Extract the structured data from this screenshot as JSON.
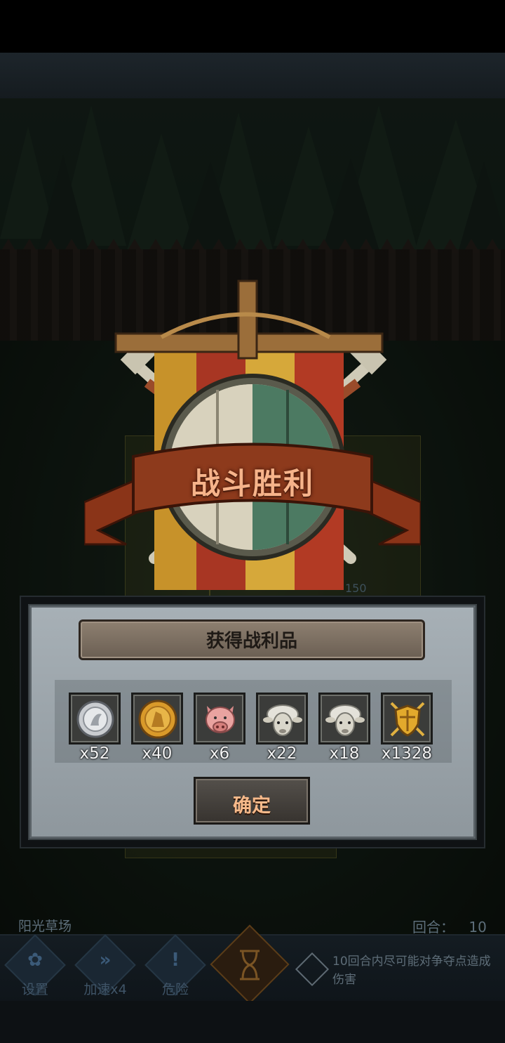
{
  "victory": {
    "title": "战斗胜利"
  },
  "loot_panel": {
    "title": "获得战利品",
    "items": [
      {
        "icon": "silver-coin-icon",
        "qty": "x52"
      },
      {
        "icon": "gold-coin-icon",
        "qty": "x40"
      },
      {
        "icon": "pig-icon",
        "qty": "x6"
      },
      {
        "icon": "sheep-icon",
        "qty": "x22"
      },
      {
        "icon": "sheep-icon",
        "qty": "x18"
      },
      {
        "icon": "shield-emblem-icon",
        "qty": "x1328"
      }
    ],
    "confirm_label": "确定"
  },
  "field": {
    "enemy_hp": "150"
  },
  "hud": {
    "stage_name": "阳光草场",
    "round_label": "回合：",
    "round_value": "10",
    "settings_label": "设置",
    "speed_label": "加速x4",
    "danger_label": "危险",
    "objective_text": "10回合内尽可能对争夺点造成伤害"
  },
  "colors": {
    "title_text": "#f6b38a",
    "panel_bg": "#9aa3a9",
    "banner_red": "#b23a24",
    "banner_yellow": "#d9a92c",
    "banner_green": "#4c7a62"
  }
}
